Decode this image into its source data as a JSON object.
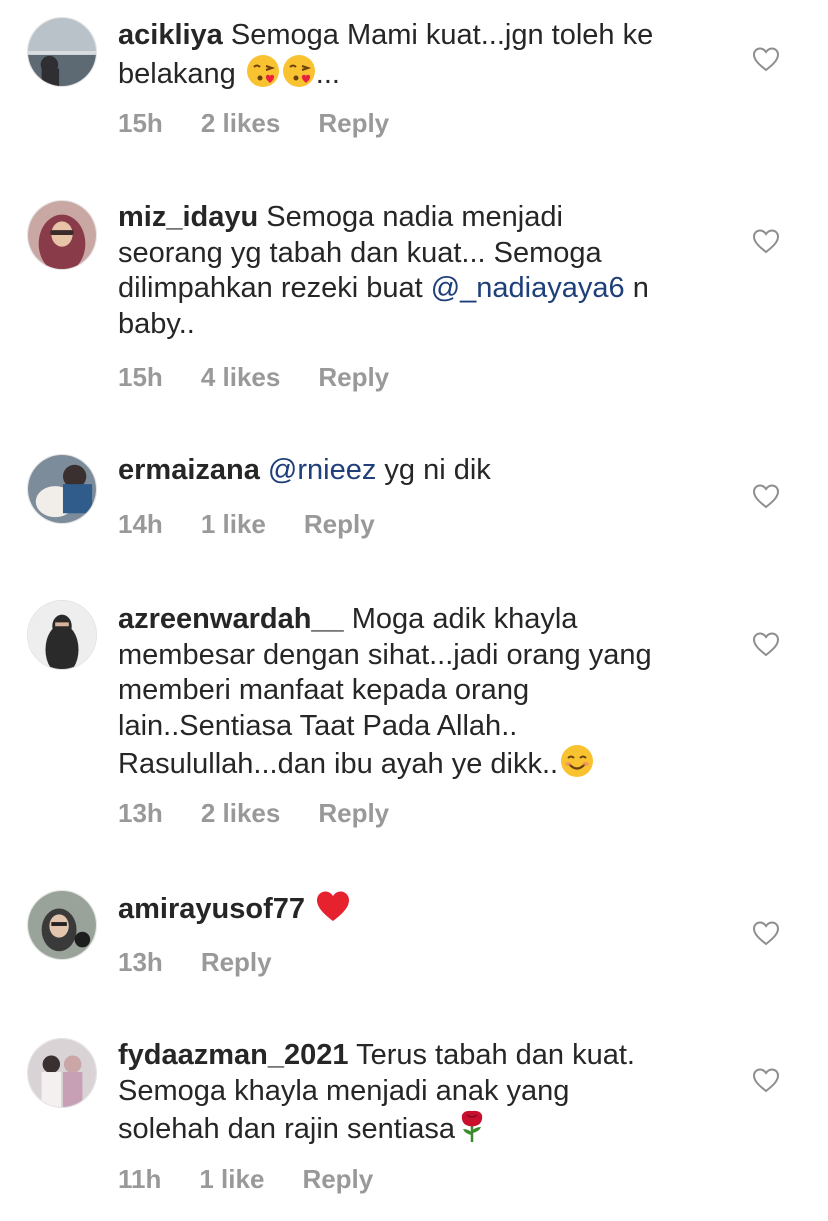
{
  "comments": [
    {
      "username": "acikliya",
      "text": " Semoga Mami kuat...jgn toleh ke\nbelakang ",
      "trailing": "...",
      "time": "15h",
      "likes": "2 likes",
      "reply": "Reply"
    },
    {
      "username": "miz_idayu",
      "text": " Semoga nadia menjadi\nseorang yg tabah dan kuat... Semoga\ndilimpahkan rezeki buat ",
      "mention": "@_nadiayaya6",
      "trailing": " n\nbaby..",
      "time": "15h",
      "likes": "4 likes",
      "reply": "Reply"
    },
    {
      "username": "ermaizana",
      "text": " ",
      "mention": "@rnieez",
      "trailing": " yg ni dik",
      "time": "14h",
      "likes": "1 like",
      "reply": "Reply"
    },
    {
      "username": "azreenwardah__",
      "text": " Moga adik khayla\nmembesar dengan sihat...jadi orang yang\nmemberi manfaat kepada orang\nlain..Sentiasa Taat Pada Allah..\nRasulullah...dan ibu ayah ye dikk..",
      "time": "13h",
      "likes": "2 likes",
      "reply": "Reply"
    },
    {
      "username": "amirayusof77",
      "text": " ",
      "time": "13h",
      "reply": "Reply"
    },
    {
      "username": "fydaazman_2021",
      "text": " Terus tabah dan kuat.\nSemoga khayla menjadi anak yang\nsolehah dan rajin sentiasa",
      "time": "11h",
      "likes": "1 like",
      "reply": "Reply"
    }
  ],
  "icons": {
    "like": "heart-outline-icon",
    "kiss": "face-blowing-kiss-emoji",
    "smile": "smiling-face-emoji",
    "red_heart": "red-heart-emoji",
    "rose": "rose-emoji"
  },
  "colors": {
    "text": "#262626",
    "meta": "#999999",
    "mention": "#1e3f7a",
    "heart_outline": "#8e8e8e"
  }
}
